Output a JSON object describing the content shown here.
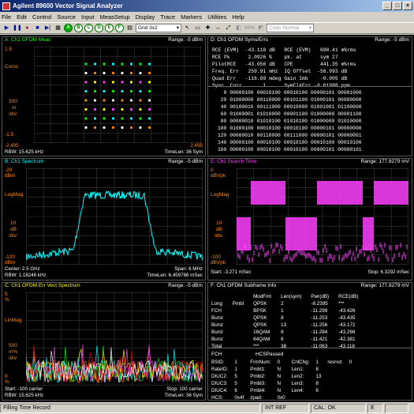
{
  "window": {
    "title": "Agilent 89600 Vector Signal Analyzer"
  },
  "menu": [
    "File",
    "Edit",
    "Control",
    "Source",
    "Input",
    "MeasSetup",
    "Display",
    "Trace",
    "Markers",
    "Utilities",
    "Help"
  ],
  "toolbar": {
    "trace_letters": [
      "A",
      "B",
      "C",
      "D",
      "E",
      "F"
    ],
    "grid_select": "Grid 3x2",
    "percent": "50%",
    "color_select": "Color Normal"
  },
  "panes": {
    "a": {
      "title": "A: Ch1 OFDM Meas",
      "range": "Range: -5 dBm",
      "label": "Const",
      "y_top": "1.5",
      "y_mid": "300",
      "y_unit": "m",
      "y_div": "/div",
      "y_bot": "-1.5",
      "x_left": "-2.495",
      "x_right": "2.495",
      "rbw": "RBW: 15.625 kHz",
      "timelen": "TimeLen: 36  Sym"
    },
    "b": {
      "title": "B: Ch1 Spectrum",
      "range": "Range: -5 dBm",
      "label": "LogMag",
      "y_top": "-20",
      "y_top_unit": "dBm",
      "y_mid": "10",
      "y_mid_unit": "dB",
      "y_div": "/div",
      "y_bot": "-120",
      "y_bot_unit": "dBm",
      "center": "Center: 2.5 GHz",
      "span": "Span: 6 MHz",
      "rbw": "RBW: 1.18248 kHz",
      "timelen": "TimeLen: 6.459766 mSec"
    },
    "c": {
      "title": "C: Ch1 OFDM Err Vect Spectrum",
      "range": "Range: -5 dBm",
      "label": "LinMag",
      "y_top": "5",
      "y_top_unit": "%",
      "y_mid": "500",
      "y_mid_unit": "m%",
      "y_div": "/div",
      "y_bot": "0",
      "y_bot_unit": "%",
      "start": "Start: -100  carrier",
      "stop": "Stop: 100  carrier",
      "rbw": "RBW: 15.625 kHz",
      "timelen": "TimeLen: 36  Sym"
    },
    "d": {
      "title": "D: Ch1 OFDM Syms/Errs",
      "range": "Range: -5 dBm",
      "stats_left": [
        [
          "RCE (EVM)",
          "-43.118",
          "dB"
        ],
        [
          "RCE Pk",
          "2.0926",
          "%"
        ],
        [
          "PilotRCE",
          "-43.056",
          "dB"
        ],
        [
          "Freq. Err",
          "259.91",
          "mHz"
        ],
        [
          "Quad Err",
          "-116.89",
          "mdeg"
        ],
        [
          "Sync. Corr",
          "1",
          ""
        ]
      ],
      "stats_right": [
        [
          "RCE (EVM)",
          "698.41",
          "m%rms"
        ],
        [
          "pk. at",
          "sym 27",
          ""
        ],
        [
          "CPE",
          "441.35",
          "m%rms"
        ],
        [
          "IQ Offset",
          "-56.993",
          "dB"
        ],
        [
          "Gain Imb",
          "-0.005",
          "dB"
        ],
        [
          "SymClkErr",
          "-0.01988",
          "ppm"
        ]
      ],
      "symbols": [
        [
          "0",
          "00000100",
          "00010100",
          "00010100",
          "00000101",
          "00001000"
        ],
        [
          "20",
          "01000000",
          "00110000",
          "00101100",
          "01000101",
          "00000000"
        ],
        [
          "40",
          "00100010",
          "00111000",
          "00010000",
          "01001001",
          "01100000"
        ],
        [
          "60",
          "01000001",
          "01010000",
          "00001100",
          "01000000",
          "00001100"
        ],
        [
          "80",
          "00000010",
          "01010100",
          "01010100",
          "01000000",
          "01010000"
        ],
        [
          "100",
          "01000100",
          "00010100",
          "00010100",
          "00000101",
          "00000000"
        ],
        [
          "120",
          "00000010",
          "00110000",
          "00111000",
          "00000101",
          "00000001"
        ],
        [
          "140",
          "00000100",
          "00010100",
          "00010100",
          "00010100",
          "00010100"
        ],
        [
          "160",
          "00000100",
          "00010100",
          "00010100",
          "00000101",
          "00000101"
        ]
      ]
    },
    "e": {
      "title": "E: Ch1 Search Time",
      "range": "Range: 177.8279 mV",
      "label": "LogMag",
      "y_top": "0",
      "y_top_unit": "dBVpk",
      "y_mid": "10",
      "y_mid_unit": "dB",
      "y_div": "/div",
      "y_bot": "-100",
      "y_bot_unit": "dBVpk",
      "start": "Start: -3.271 mSec",
      "stop": "Stop: 6.3292 mSec"
    },
    "f": {
      "title": "F: Ch1 OFDM Subframe Info",
      "range": "Range: 177.8279 mV",
      "headers": [
        "",
        "",
        "ModFmt",
        "Len(sym)",
        "Pwr(dB)",
        "RCE(dB)"
      ],
      "rows": [
        [
          "Long",
          "Pmbl",
          "QPSK",
          "2",
          "-8.2395",
          "***"
        ],
        [
          "FCH",
          "",
          "BPSK",
          "1",
          "-11.299",
          "-43.426"
        ],
        [
          "Burst",
          "",
          "QPSK",
          "8",
          "-11.253",
          "-43.435"
        ],
        [
          "Burst",
          "",
          "QPSK",
          "13",
          "-11.256",
          "-43.172"
        ],
        [
          "Burst",
          "",
          "16QAM",
          "8",
          "-11.284",
          "-43.266"
        ],
        [
          "Burst",
          "",
          "64QAM",
          "6",
          "-11.421",
          "-42.381"
        ],
        [
          "Total",
          "",
          "***",
          "38",
          "-11.063",
          "-43.118"
        ]
      ],
      "fch_title": "FCH",
      "hcs_title": "HCSPassed",
      "fch_rows": [
        [
          "BSID:",
          "1",
          "FrmNum:",
          "0",
          "CnlChg:",
          "1",
          "resrvd:",
          "0"
        ],
        [
          "RateID:",
          "1",
          "Pmbl1:",
          "N",
          "Len1:",
          "8",
          "",
          ""
        ],
        [
          "DIUC2:",
          "5",
          "Pmbl2:",
          "N",
          "Len2:",
          "13",
          "",
          ""
        ],
        [
          "DIUC3:",
          "5",
          "Pmbl3:",
          "N",
          "Len3:",
          "8",
          "",
          ""
        ],
        [
          "DIUC4:",
          "6",
          "Pmbl4:",
          "N",
          "Len4:",
          "6",
          "",
          ""
        ],
        [
          "HCS:",
          "0x4f",
          "zpad:",
          "0x0",
          "",
          "",
          "",
          ""
        ]
      ]
    }
  },
  "status": {
    "message": "Filling Time Record",
    "ref": "INT REF",
    "cal": "CAL: OK",
    "ext": "E"
  },
  "colors": {
    "constellation": "#00ff00",
    "spectrum": "#00ffff",
    "search_time": "#ff40ff",
    "err_vect": "#ffff00"
  }
}
